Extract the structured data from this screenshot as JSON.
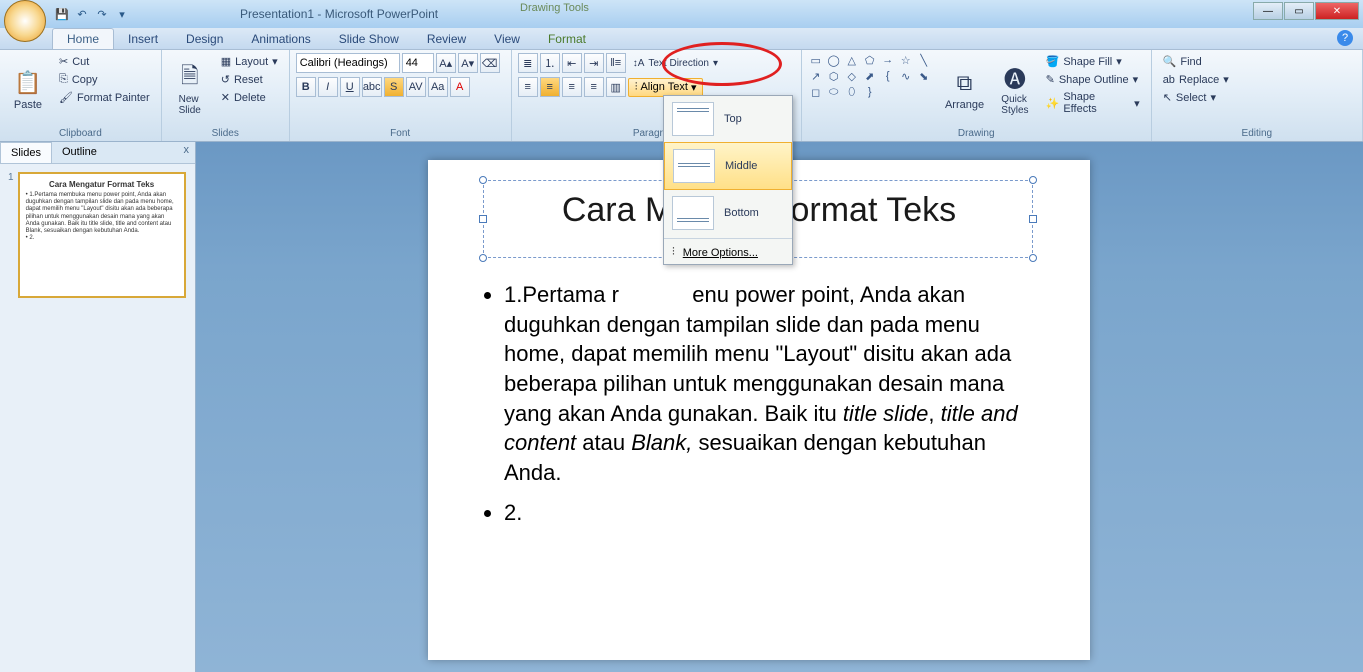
{
  "app": {
    "title": "Presentation1 - Microsoft PowerPoint",
    "contextual_label": "Drawing Tools"
  },
  "tabs": {
    "home": "Home",
    "insert": "Insert",
    "design": "Design",
    "animations": "Animations",
    "slideshow": "Slide Show",
    "review": "Review",
    "view": "View",
    "format": "Format"
  },
  "ribbon": {
    "clipboard": {
      "paste": "Paste",
      "cut": "Cut",
      "copy": "Copy",
      "painter": "Format Painter",
      "label": "Clipboard"
    },
    "slides": {
      "new_slide": "New\nSlide",
      "layout": "Layout",
      "reset": "Reset",
      "delete": "Delete",
      "label": "Slides"
    },
    "font": {
      "family": "Calibri (Headings)",
      "size": "44",
      "label": "Font"
    },
    "paragraph": {
      "text_direction": "Text Direction",
      "align_text": "Align Text",
      "label": "Paragraph"
    },
    "drawing": {
      "arrange": "Arrange",
      "quick": "Quick\nStyles",
      "fill": "Shape Fill",
      "outline": "Shape Outline",
      "effects": "Shape Effects",
      "label": "Drawing"
    },
    "editing": {
      "find": "Find",
      "replace": "Replace",
      "select": "Select",
      "label": "Editing"
    }
  },
  "align_menu": {
    "top": "Top",
    "middle": "Middle",
    "bottom": "Bottom",
    "more": "More Options..."
  },
  "side": {
    "slides": "Slides",
    "outline": "Outline"
  },
  "slide": {
    "title": "Cara Mengatur Format Teks",
    "bullet1_a": "1.Pertama membuka menu power point, Anda akan duguhkan dengan tampilan slide dan pada menu home, dapat memilih menu \"Layout\" disitu akan ada beberapa pilihan untuk menggunakan desain mana yang akan Anda gunakan. Baik itu ",
    "bullet1_b": "title slide",
    "bullet1_c": ", ",
    "bullet1_d": "title and content",
    "bullet1_e": " atau ",
    "bullet1_f": "Blank,",
    "bullet1_g": " sesuaikan dengan kebutuhan Anda.",
    "bullet2": "2."
  },
  "thumb": {
    "title": "Cara Mengatur Format Teks",
    "body": "1.Pertama membuka menu power point, Anda akan duguhkan dengan tampilan slide dan pada menu home, dapat memilih menu \"Layout\" disitu akan ada beberapa pilihan untuk menggunakan desain mana yang akan Anda gunakan. Baik itu title slide, title and content atau Blank, sesuaikan dengan kebutuhan Anda.",
    "b2": "2."
  }
}
